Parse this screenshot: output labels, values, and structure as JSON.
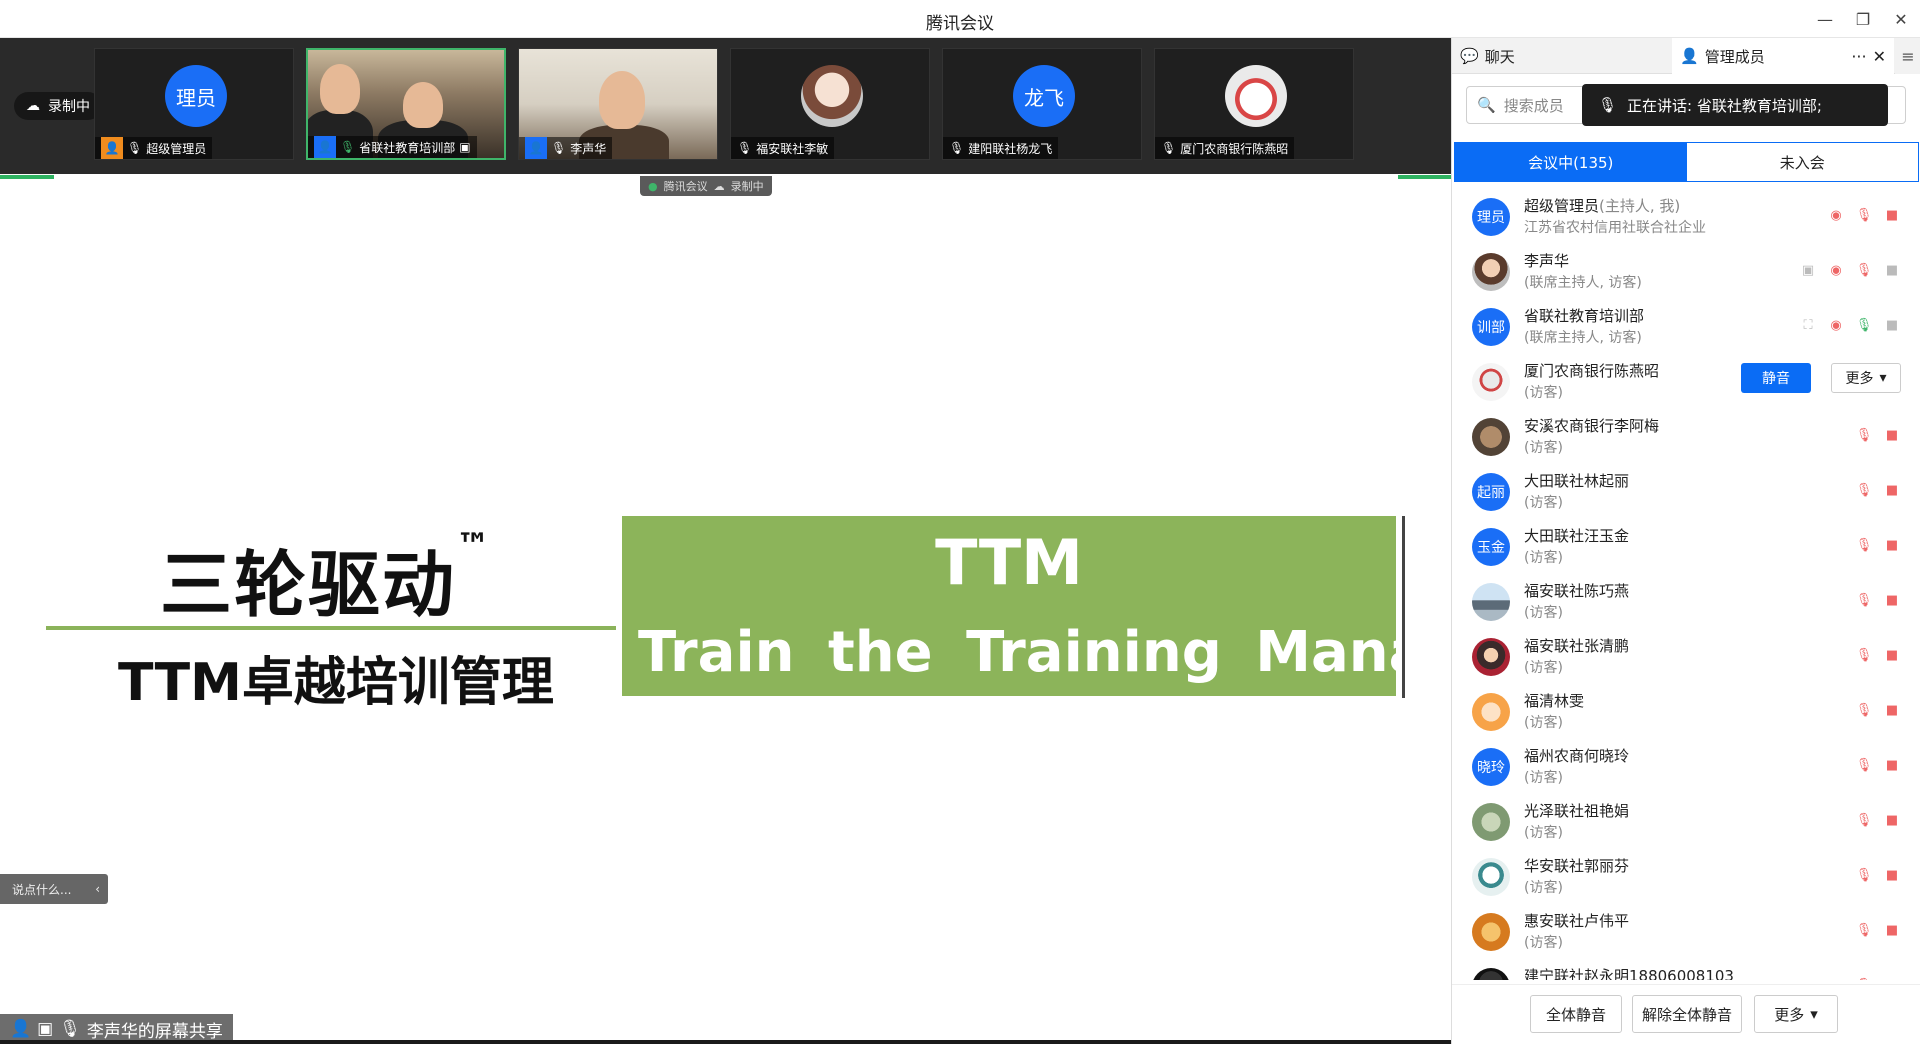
{
  "window": {
    "title": "腾讯会议"
  },
  "video_strip": {
    "recording_pill": "录制中",
    "tiles": [
      {
        "name": "超级管理员",
        "avatar_text": "理员"
      },
      {
        "name": "省联社教育培训部"
      },
      {
        "name": "李声华"
      },
      {
        "name": "福安联社李敏"
      },
      {
        "name": "建阳联社杨龙飞",
        "avatar_text": "龙飞"
      },
      {
        "name": "厦门农商银行陈燕昭"
      }
    ],
    "mini_status": {
      "app": "腾讯会议",
      "rec": "录制中"
    }
  },
  "slide": {
    "title": "三轮驱动",
    "title_mark": "™",
    "subtitle": "TTM卓越培训管理",
    "box_big": "TTM",
    "box_line": "Train the Training Manager"
  },
  "chat_input": {
    "placeholder": "说点什么..."
  },
  "share_label": "李声华的屏幕共享",
  "panel": {
    "tab_chat": "聊天",
    "tab_manage": "管理成员",
    "search_placeholder": "搜索成员",
    "speaking": "正在讲话: 省联社教育培训部;",
    "seg_in": "会议中(135)",
    "seg_out": "未入会",
    "members": [
      {
        "name": "超级管理员",
        "name_role": "(主持人, 我)",
        "role": "江苏省农村信用社联合社企业",
        "avatar_text": "理员"
      },
      {
        "name": "李声华",
        "role": "(联席主持人, 访客)"
      },
      {
        "name": "省联社教育培训部",
        "role": "(联席主持人, 访客)",
        "avatar_text": "训部"
      },
      {
        "name": "厦门农商银行陈燕昭",
        "role": "(访客)",
        "mute_label": "静音",
        "more_label": "更多"
      },
      {
        "name": "安溪农商银行李阿梅",
        "role": "(访客)"
      },
      {
        "name": "大田联社林起丽",
        "role": "(访客)",
        "avatar_text": "起丽"
      },
      {
        "name": "大田联社汪玉金",
        "role": "(访客)",
        "avatar_text": "玉金"
      },
      {
        "name": "福安联社陈巧燕",
        "role": "(访客)"
      },
      {
        "name": "福安联社张清鹏",
        "role": "(访客)"
      },
      {
        "name": "福清林雯",
        "role": "(访客)"
      },
      {
        "name": "福州农商何晓玲",
        "role": "(访客)",
        "avatar_text": "晓玲"
      },
      {
        "name": "光泽联社祖艳娟",
        "role": "(访客)"
      },
      {
        "name": "华安联社郭丽芬",
        "role": "(访客)"
      },
      {
        "name": "惠安联社卢伟平",
        "role": "(访客)"
      },
      {
        "name": "建宁联社赵永明18806008103",
        "role": ""
      }
    ],
    "footer": {
      "mute_all": "全体静音",
      "unmute_all": "解除全体静音",
      "more": "更多"
    }
  }
}
